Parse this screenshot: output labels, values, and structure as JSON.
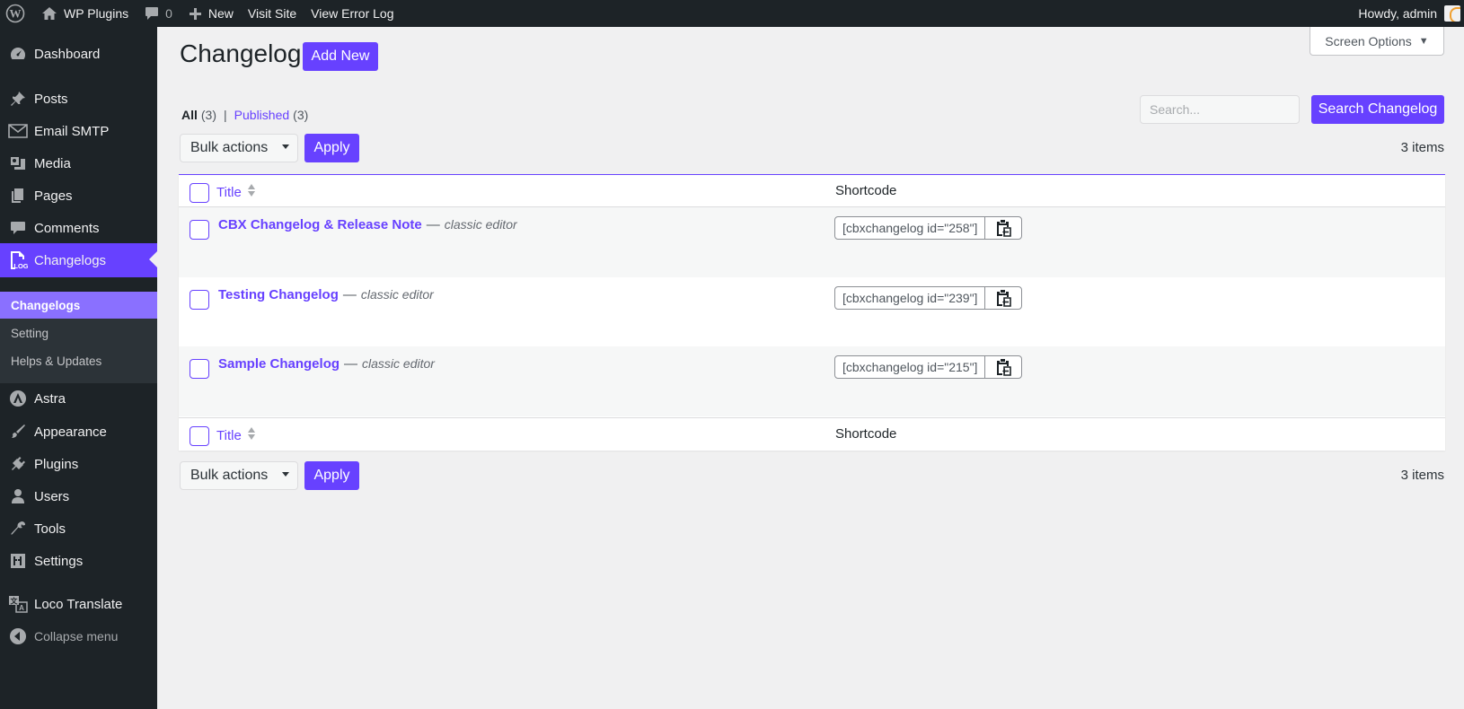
{
  "admin_bar": {
    "site_name": "WP Plugins",
    "comments_count": "0",
    "new_label": "New",
    "visit_site_label": "Visit Site",
    "error_log_label": "View Error Log",
    "greeting": "Howdy, admin"
  },
  "sidebar": {
    "items": [
      {
        "label": "Dashboard",
        "icon": "dashboard-icon"
      },
      {
        "label": "Posts",
        "icon": "pin-icon"
      },
      {
        "label": "Email SMTP",
        "icon": "mail-icon"
      },
      {
        "label": "Media",
        "icon": "media-icon"
      },
      {
        "label": "Pages",
        "icon": "pages-icon"
      },
      {
        "label": "Comments",
        "icon": "comment-icon"
      },
      {
        "label": "Changelogs",
        "icon": "changelog-log-icon"
      },
      {
        "label": "Astra",
        "icon": "astra-icon"
      },
      {
        "label": "Appearance",
        "icon": "brush-icon"
      },
      {
        "label": "Plugins",
        "icon": "plug-icon"
      },
      {
        "label": "Users",
        "icon": "user-icon"
      },
      {
        "label": "Tools",
        "icon": "wrench-icon"
      },
      {
        "label": "Settings",
        "icon": "settings-icon"
      },
      {
        "label": "Loco Translate",
        "icon": "translate-icon"
      }
    ],
    "submenu": [
      "Changelogs",
      "Setting",
      "Helps & Updates"
    ],
    "collapse_label": "Collapse menu"
  },
  "page": {
    "title": "Changelog",
    "add_new_label": "Add New",
    "screen_options_label": "Screen Options",
    "filters": {
      "all_label": "All",
      "all_count": "(3)",
      "published_label": "Published",
      "published_count": "(3)"
    },
    "search": {
      "placeholder": "Search...",
      "button_label": "Search Changelog"
    },
    "bulk_actions_label": "Bulk actions",
    "apply_label": "Apply",
    "items_count": "3 items"
  },
  "table": {
    "columns": {
      "title": "Title",
      "shortcode": "Shortcode"
    },
    "rows": [
      {
        "title": "CBX Changelog & Release Note",
        "separator": "—",
        "state": "classic editor",
        "shortcode": "[cbxchangelog id=\"258\"]"
      },
      {
        "title": "Testing Changelog",
        "separator": "—",
        "state": "classic editor",
        "shortcode": "[cbxchangelog id=\"239\"]"
      },
      {
        "title": "Sample Changelog",
        "separator": "—",
        "state": "classic editor",
        "shortcode": "[cbxchangelog id=\"215\"]"
      }
    ]
  },
  "colors": {
    "accent": "#6741ff",
    "sidebar_bg": "#1d2327",
    "page_bg": "#f0f0f1"
  }
}
